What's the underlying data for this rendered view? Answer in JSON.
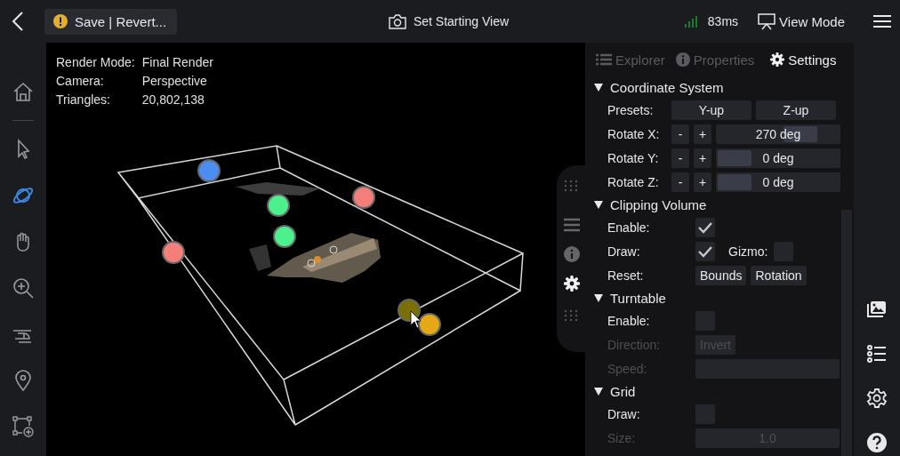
{
  "top_bar": {
    "save_button": "Save | Revert...",
    "set_view_button": "Set Starting View",
    "latency": "83ms",
    "view_mode_button": "View Mode"
  },
  "toolbar": [
    {
      "kind": "home",
      "selected": false
    },
    {
      "kind": "pointer",
      "selected": false
    },
    {
      "kind": "orbit",
      "selected": true
    },
    {
      "kind": "pan",
      "selected": false
    },
    {
      "kind": "zoom",
      "selected": false
    },
    {
      "kind": "helicopter",
      "selected": false
    },
    {
      "kind": "pin",
      "selected": false
    },
    {
      "kind": "measure",
      "selected": false
    }
  ],
  "viewport": {
    "info": [
      {
        "label": "Render Mode:",
        "value": "Final Render"
      },
      {
        "label": "Camera:",
        "value": "Perspective"
      },
      {
        "label": "Triangles:",
        "value": "20,802,138"
      }
    ],
    "handles": [
      {
        "color": "#4a8ef0"
      },
      {
        "color": "#4cf08c"
      },
      {
        "color": "#4cf08c"
      },
      {
        "color": "#f47f7a"
      },
      {
        "color": "#f47f7a"
      },
      {
        "color": "#7a6f00"
      },
      {
        "color": "#e6a817"
      }
    ]
  },
  "panel_tabs": [
    {
      "label": "Explorer",
      "selected": false
    },
    {
      "label": "Properties",
      "selected": false
    },
    {
      "label": "Settings",
      "selected": true
    }
  ],
  "sections": [
    {
      "title": "Coordinate System",
      "expanded": true,
      "rows": [
        {
          "kind": "presets",
          "label": "Presets:",
          "disabled": false,
          "buttons": [
            "Y-up",
            "Z-up"
          ]
        },
        {
          "kind": "rotate",
          "label": "Rotate X:",
          "disabled": false,
          "minus": "-",
          "plus": "+",
          "value": "270 deg",
          "level": 0.75
        },
        {
          "kind": "rotate",
          "label": "Rotate Y:",
          "disabled": false,
          "minus": "-",
          "plus": "+",
          "value": "0 deg",
          "level": 0
        },
        {
          "kind": "rotate",
          "label": "Rotate Z:",
          "disabled": false,
          "minus": "-",
          "plus": "+",
          "value": "0 deg",
          "level": 0
        }
      ]
    },
    {
      "title": "Clipping Volume",
      "expanded": true,
      "rows": [
        {
          "kind": "checkbox",
          "label": "Enable:",
          "disabled": false,
          "checked": true
        },
        {
          "kind": "checkbox-pair",
          "label": "Draw:",
          "disabled": false,
          "checked": true,
          "second_label": "Gizmo:",
          "second_checked": false
        },
        {
          "kind": "actions",
          "label": "Reset:",
          "disabled": false,
          "buttons": [
            "Bounds",
            "Rotation"
          ]
        }
      ]
    },
    {
      "title": "Turntable",
      "expanded": true,
      "rows": [
        {
          "kind": "checkbox",
          "label": "Enable:",
          "disabled": false,
          "checked": false
        },
        {
          "kind": "actions",
          "label": "Direction:",
          "disabled": true,
          "buttons": [
            "Invert"
          ]
        },
        {
          "kind": "field",
          "label": "Speed:",
          "disabled": true
        }
      ]
    },
    {
      "title": "Grid",
      "expanded": true,
      "rows": [
        {
          "kind": "checkbox",
          "label": "Draw:",
          "disabled": false,
          "checked": false
        },
        {
          "kind": "field",
          "label": "Size:",
          "disabled": true,
          "value": "1.0"
        }
      ]
    }
  ]
}
